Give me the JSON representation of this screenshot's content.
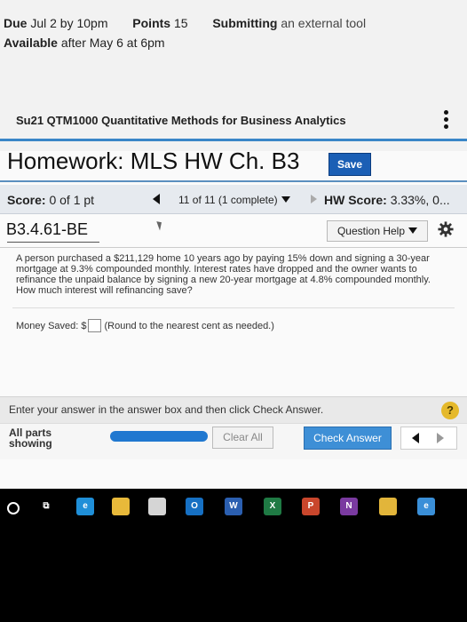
{
  "assignment": {
    "due_label": "Due",
    "due_value": "Jul 2 by 10pm",
    "points_label": "Points",
    "points_value": "15",
    "submitting_label": "Submitting",
    "submitting_value": "an external tool",
    "available_label": "Available",
    "available_value": "after May 6 at 6pm"
  },
  "course": {
    "title": "Su21 QTM1000 Quantitative Methods for Business Analytics"
  },
  "homework": {
    "title": "Homework: MLS HW Ch. B3",
    "save_label": "Save"
  },
  "scorebar": {
    "score_label": "Score:",
    "score_value": "0 of 1 pt",
    "question_counter": "11 of 11 (1 complete)",
    "hw_score_label": "HW Score:",
    "hw_score_value": "3.33%, 0..."
  },
  "question": {
    "id": "B3.4.61-BE",
    "help_label": "Question Help",
    "text": "A person purchased a $211,129 home 10 years ago by paying 15% down and signing a 30-year mortgage at 9.3% compounded monthly. Interest rates have dropped and the owner wants to refinance the unpaid balance by signing a new 20-year mortgage at 4.8% compounded monthly. How much interest will refinancing save?",
    "answer_label": "Money Saved: $",
    "answer_value": "",
    "answer_hint": "(Round to the nearest cent as needed.)"
  },
  "footer": {
    "instruction": "Enter your answer in the answer box and then click Check Answer.",
    "help_glyph": "?",
    "parts_line1": "All parts",
    "parts_line2": "showing",
    "progress": 1.0,
    "clear_label": "Clear All",
    "check_label": "Check Answer"
  },
  "taskbar": {
    "apps": [
      {
        "name": "search-icon",
        "glyph": "O",
        "color": "#000000"
      },
      {
        "name": "task-view-icon",
        "glyph": "⧉",
        "color": "#000000"
      },
      {
        "name": "edge-icon",
        "glyph": "e",
        "color": "#1f8fd8"
      },
      {
        "name": "file-explorer-icon",
        "glyph": "",
        "color": "#e8b93a"
      },
      {
        "name": "store-icon",
        "glyph": "",
        "color": "#d5d5d5"
      },
      {
        "name": "outlook-icon",
        "glyph": "O",
        "color": "#1670c3"
      },
      {
        "name": "word-icon",
        "glyph": "W",
        "color": "#2b5fb0"
      },
      {
        "name": "excel-icon",
        "glyph": "X",
        "color": "#1f7a44"
      },
      {
        "name": "powerpoint-icon",
        "glyph": "P",
        "color": "#c9462c"
      },
      {
        "name": "onenote-icon",
        "glyph": "N",
        "color": "#7a3aa0"
      },
      {
        "name": "chrome-icon",
        "glyph": "",
        "color": "#e2b53a"
      },
      {
        "name": "internet-explorer-icon",
        "glyph": "e",
        "color": "#3a8fd8"
      }
    ]
  }
}
